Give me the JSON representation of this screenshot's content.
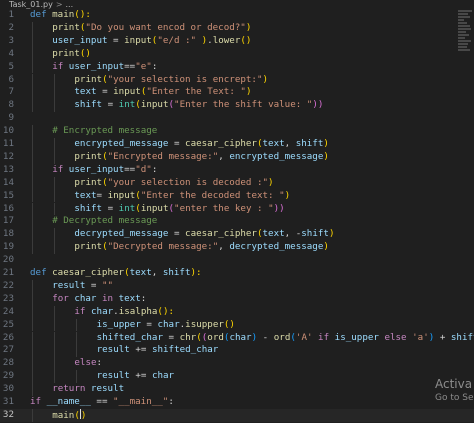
{
  "breadcrumb": {
    "file": "Task_01.py",
    "sep": ">",
    "symbol": "..."
  },
  "minimap_color": "#5a5a5a",
  "watermark": {
    "line1": "Activa",
    "line2": "Go to Se"
  },
  "lines": [
    {
      "n": "1",
      "i": 0,
      "t": [
        [
          "def ",
          "t-def"
        ],
        [
          "main",
          "t-fn"
        ],
        [
          "():",
          "t-b1"
        ]
      ]
    },
    {
      "n": "2",
      "i": 1,
      "t": [
        [
          "print",
          "t-fn"
        ],
        [
          "(",
          "t-b1"
        ],
        [
          "\"Do you want encod or decod?\"",
          "t-str"
        ],
        [
          ")",
          "t-b1"
        ]
      ]
    },
    {
      "n": "3",
      "i": 1,
      "t": [
        [
          "user_input",
          "t-var"
        ],
        [
          " = ",
          "t-op"
        ],
        [
          "input",
          "t-fn"
        ],
        [
          "(",
          "t-b1"
        ],
        [
          "\"e/d :\" ",
          "t-str"
        ],
        [
          ")",
          "t-b1"
        ],
        [
          ".",
          "t-op"
        ],
        [
          "lower",
          "t-fn"
        ],
        [
          "()",
          "t-b1"
        ]
      ]
    },
    {
      "n": "4",
      "i": 1,
      "t": [
        [
          "print",
          "t-fn"
        ],
        [
          "()",
          "t-b1"
        ]
      ]
    },
    {
      "n": "5",
      "i": 1,
      "t": [
        [
          "if ",
          "t-kw"
        ],
        [
          "user_input",
          "t-var"
        ],
        [
          "==",
          "t-op"
        ],
        [
          "\"e\"",
          "t-str"
        ],
        [
          ":",
          "t-op"
        ]
      ]
    },
    {
      "n": "6",
      "i": 2,
      "t": [
        [
          "print",
          "t-fn"
        ],
        [
          "(",
          "t-b1"
        ],
        [
          "\"your selection is encrept:\"",
          "t-str"
        ],
        [
          ")",
          "t-b1"
        ]
      ]
    },
    {
      "n": "7",
      "i": 2,
      "t": [
        [
          "text",
          "t-var"
        ],
        [
          " = ",
          "t-op"
        ],
        [
          "input",
          "t-fn"
        ],
        [
          "(",
          "t-b1"
        ],
        [
          "\"Enter the Text: \"",
          "t-str"
        ],
        [
          ")",
          "t-b1"
        ]
      ]
    },
    {
      "n": "8",
      "i": 2,
      "t": [
        [
          "shift",
          "t-var"
        ],
        [
          " = ",
          "t-op"
        ],
        [
          "int",
          "t-cls"
        ],
        [
          "(",
          "t-b1"
        ],
        [
          "input",
          "t-fn"
        ],
        [
          "(",
          "t-b2"
        ],
        [
          "\"Enter the shift value: \"",
          "t-str"
        ],
        [
          "))",
          "t-b2"
        ]
      ]
    },
    {
      "n": "9",
      "i": 0,
      "t": []
    },
    {
      "n": "10",
      "i": 1,
      "t": [
        [
          "# Encrypted message",
          "t-cmt"
        ]
      ]
    },
    {
      "n": "11",
      "i": 2,
      "t": [
        [
          "encrypted_message",
          "t-var"
        ],
        [
          " = ",
          "t-op"
        ],
        [
          "caesar_cipher",
          "t-fn"
        ],
        [
          "(",
          "t-b1"
        ],
        [
          "text",
          "t-var"
        ],
        [
          ", ",
          "t-op"
        ],
        [
          "shift",
          "t-var"
        ],
        [
          ")",
          "t-b1"
        ]
      ]
    },
    {
      "n": "12",
      "i": 2,
      "t": [
        [
          "print",
          "t-fn"
        ],
        [
          "(",
          "t-b1"
        ],
        [
          "\"Encrypted message:\"",
          "t-str"
        ],
        [
          ", ",
          "t-op"
        ],
        [
          "encrypted_message",
          "t-var"
        ],
        [
          ")",
          "t-b1"
        ]
      ]
    },
    {
      "n": "13",
      "i": 1,
      "t": [
        [
          "if ",
          "t-kw"
        ],
        [
          "user_input",
          "t-var"
        ],
        [
          "==",
          "t-op"
        ],
        [
          "\"d\"",
          "t-str"
        ],
        [
          ":",
          "t-op"
        ]
      ]
    },
    {
      "n": "14",
      "i": 2,
      "t": [
        [
          "print",
          "t-fn"
        ],
        [
          "(",
          "t-b1"
        ],
        [
          "\"your selection is decoded :\"",
          "t-str"
        ],
        [
          ")",
          "t-b1"
        ]
      ]
    },
    {
      "n": "15",
      "i": 2,
      "t": [
        [
          "text",
          "t-var"
        ],
        [
          "= ",
          "t-op"
        ],
        [
          "input",
          "t-fn"
        ],
        [
          "(",
          "t-b1"
        ],
        [
          "\"Enter the decoded text: \"",
          "t-str"
        ],
        [
          ")",
          "t-b1"
        ]
      ]
    },
    {
      "n": "16",
      "i": 2,
      "t": [
        [
          "shift",
          "t-var"
        ],
        [
          " = ",
          "t-op"
        ],
        [
          "int",
          "t-cls"
        ],
        [
          "(",
          "t-b1"
        ],
        [
          "input",
          "t-fn"
        ],
        [
          "(",
          "t-b2"
        ],
        [
          "\"enter the key : \"",
          "t-str"
        ],
        [
          "))",
          "t-b2"
        ]
      ]
    },
    {
      "n": "17",
      "i": 1,
      "t": [
        [
          "# Decrypted message",
          "t-cmt"
        ]
      ]
    },
    {
      "n": "18",
      "i": 2,
      "t": [
        [
          "decrypted_message",
          "t-var"
        ],
        [
          " = ",
          "t-op"
        ],
        [
          "caesar_cipher",
          "t-fn"
        ],
        [
          "(",
          "t-b1"
        ],
        [
          "text",
          "t-var"
        ],
        [
          ", -",
          "t-op"
        ],
        [
          "shift",
          "t-var"
        ],
        [
          ")",
          "t-b1"
        ]
      ]
    },
    {
      "n": "19",
      "i": 2,
      "t": [
        [
          "print",
          "t-fn"
        ],
        [
          "(",
          "t-b1"
        ],
        [
          "\"Decrypted message:\"",
          "t-str"
        ],
        [
          ", ",
          "t-op"
        ],
        [
          "decrypted_message",
          "t-var"
        ],
        [
          ")",
          "t-b1"
        ]
      ]
    },
    {
      "n": "20",
      "i": 0,
      "t": []
    },
    {
      "n": "21",
      "i": 0,
      "t": [
        [
          "def ",
          "t-def"
        ],
        [
          "caesar_cipher",
          "t-fn"
        ],
        [
          "(",
          "t-b1"
        ],
        [
          "text",
          "t-var"
        ],
        [
          ", ",
          "t-op"
        ],
        [
          "shift",
          "t-var"
        ],
        [
          "):",
          "t-b1"
        ]
      ]
    },
    {
      "n": "22",
      "i": 1,
      "t": [
        [
          "result",
          "t-var"
        ],
        [
          " = ",
          "t-op"
        ],
        [
          "\"\"",
          "t-str"
        ]
      ]
    },
    {
      "n": "23",
      "i": 1,
      "t": [
        [
          "for ",
          "t-kw"
        ],
        [
          "char",
          "t-var"
        ],
        [
          " in ",
          "t-kw"
        ],
        [
          "text",
          "t-var"
        ],
        [
          ":",
          "t-op"
        ]
      ]
    },
    {
      "n": "24",
      "i": 2,
      "t": [
        [
          "if ",
          "t-kw"
        ],
        [
          "char",
          "t-var"
        ],
        [
          ".",
          "t-op"
        ],
        [
          "isalpha",
          "t-fn"
        ],
        [
          "():",
          "t-b1"
        ]
      ]
    },
    {
      "n": "25",
      "i": 3,
      "t": [
        [
          "is_upper",
          "t-var"
        ],
        [
          " = ",
          "t-op"
        ],
        [
          "char",
          "t-var"
        ],
        [
          ".",
          "t-op"
        ],
        [
          "isupper",
          "t-fn"
        ],
        [
          "()",
          "t-b1"
        ]
      ]
    },
    {
      "n": "26",
      "i": 3,
      "t": [
        [
          "shifted_char",
          "t-var"
        ],
        [
          " = ",
          "t-op"
        ],
        [
          "chr",
          "t-fn"
        ],
        [
          "(",
          "t-b1"
        ],
        [
          "(",
          "t-b2"
        ],
        [
          "ord",
          "t-fn"
        ],
        [
          "(",
          "t-b3"
        ],
        [
          "char",
          "t-var"
        ],
        [
          ")",
          "t-b3"
        ],
        [
          " - ",
          "t-op"
        ],
        [
          "ord",
          "t-fn"
        ],
        [
          "(",
          "t-b3"
        ],
        [
          "'A'",
          "t-str"
        ],
        [
          " if ",
          "t-kw"
        ],
        [
          "is_upper",
          "t-var"
        ],
        [
          " else ",
          "t-kw"
        ],
        [
          "'a'",
          "t-str"
        ],
        [
          ")",
          "t-b3"
        ],
        [
          " + ",
          "t-op"
        ],
        [
          "shift",
          "t-var"
        ],
        [
          ")",
          "t-b2"
        ]
      ]
    },
    {
      "n": "27",
      "i": 3,
      "t": [
        [
          "result",
          "t-var"
        ],
        [
          " += ",
          "t-op"
        ],
        [
          "shifted_char",
          "t-var"
        ]
      ]
    },
    {
      "n": "28",
      "i": 2,
      "t": [
        [
          "else",
          "t-kw"
        ],
        [
          ":",
          "t-op"
        ]
      ]
    },
    {
      "n": "29",
      "i": 3,
      "t": [
        [
          "result",
          "t-var"
        ],
        [
          " += ",
          "t-op"
        ],
        [
          "char",
          "t-var"
        ]
      ]
    },
    {
      "n": "30",
      "i": 1,
      "t": [
        [
          "return ",
          "t-kw"
        ],
        [
          "result",
          "t-var"
        ]
      ]
    },
    {
      "n": "31",
      "i": 0,
      "t": [
        [
          "if ",
          "t-kw"
        ],
        [
          "__name__",
          "t-var"
        ],
        [
          " == ",
          "t-op"
        ],
        [
          "\"__main__\"",
          "t-str"
        ],
        [
          ":",
          "t-op"
        ]
      ]
    },
    {
      "n": "32",
      "i": 1,
      "c": true,
      "t": [
        [
          "main",
          "t-fn"
        ],
        [
          "(",
          "t-b1"
        ],
        [
          "CURSOR",
          "cursor"
        ],
        [
          ")",
          "t-b1"
        ]
      ]
    }
  ]
}
